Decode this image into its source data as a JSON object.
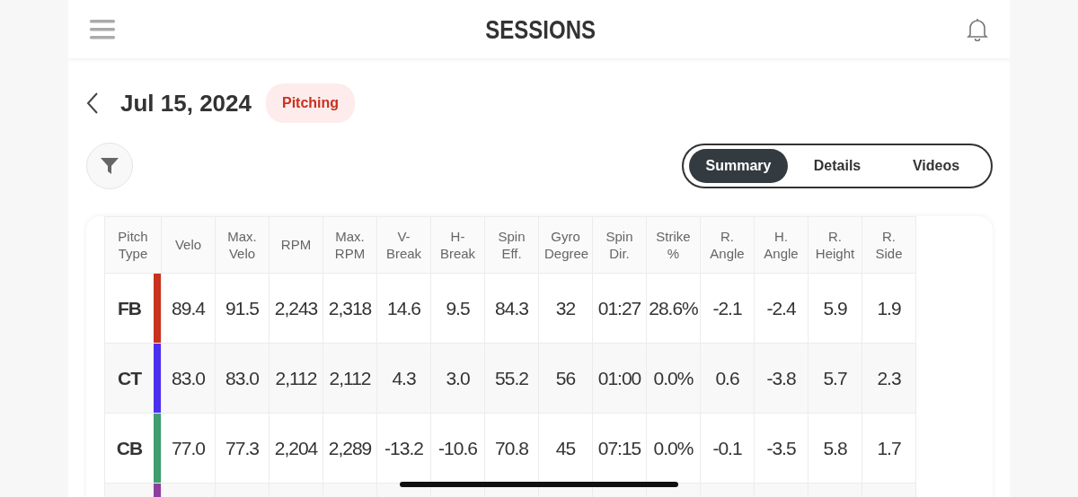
{
  "header": {
    "title": "SESSIONS"
  },
  "session": {
    "date": "Jul 15, 2024",
    "type_badge": "Pitching"
  },
  "tabs": [
    {
      "label": "Summary",
      "selected": true
    },
    {
      "label": "Details",
      "selected": false
    },
    {
      "label": "Videos",
      "selected": false
    }
  ],
  "table": {
    "columns": [
      "Pitch Type",
      "Velo",
      "Max. Velo",
      "RPM",
      "Max. RPM",
      "V-Break",
      "H-Break",
      "Spin Eff.",
      "Gyro Degree",
      "Spin Dir.",
      "Strike %",
      "R. Angle",
      "H. Angle",
      "R. Height",
      "R. Side"
    ],
    "rows": [
      {
        "color": "#c8321e",
        "cells": [
          "FB",
          "89.4",
          "91.5",
          "2,243",
          "2,318",
          "14.6",
          "9.5",
          "84.3",
          "32",
          "01:27",
          "28.6%",
          "-2.1",
          "-2.4",
          "5.9",
          "1.9"
        ]
      },
      {
        "color": "#4b2ff0",
        "cells": [
          "CT",
          "83.0",
          "83.0",
          "2,112",
          "2,112",
          "4.3",
          "3.0",
          "55.2",
          "56",
          "01:00",
          "0.0%",
          "0.6",
          "-3.8",
          "5.7",
          "2.3"
        ]
      },
      {
        "color": "#3e9e6e",
        "cells": [
          "CB",
          "77.0",
          "77.3",
          "2,204",
          "2,289",
          "-13.2",
          "-10.6",
          "70.8",
          "45",
          "07:15",
          "0.0%",
          "-0.1",
          "-3.5",
          "5.8",
          "1.7"
        ]
      },
      {
        "color": "#8e3f9e",
        "cells": []
      }
    ]
  }
}
